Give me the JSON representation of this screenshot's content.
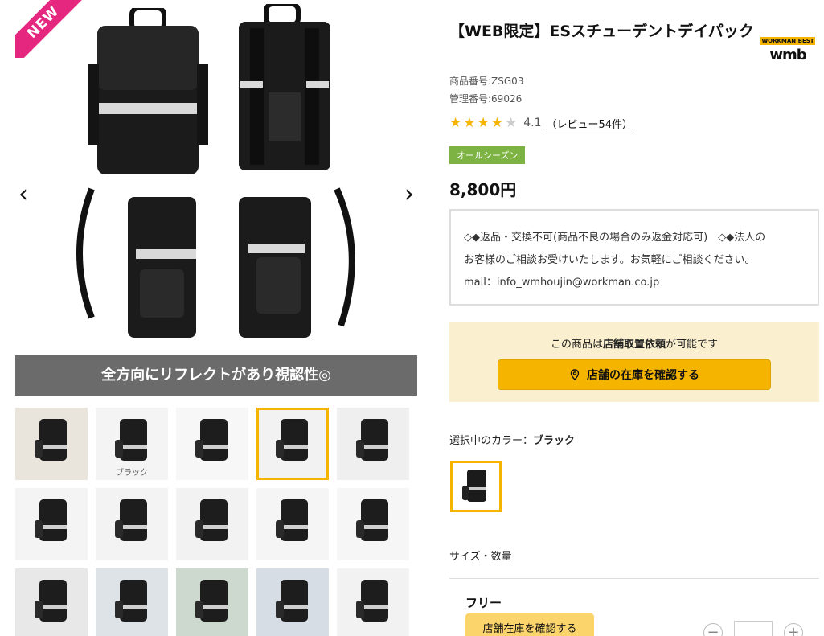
{
  "gallery": {
    "badge": "NEW",
    "prev_icon": "‹",
    "next_icon": "›",
    "caption": "全方向にリフレクトがあり視認性◎",
    "thumbnails": [
      {
        "label": ""
      },
      {
        "label": "ブラック"
      },
      {
        "label": ""
      },
      {
        "label": ""
      },
      {
        "label": ""
      },
      {
        "label": ""
      },
      {
        "label": ""
      },
      {
        "label": ""
      },
      {
        "label": ""
      },
      {
        "label": ""
      },
      {
        "label": ""
      },
      {
        "label": ""
      },
      {
        "label": ""
      },
      {
        "label": ""
      },
      {
        "label": ""
      }
    ],
    "active_thumb": 3
  },
  "product": {
    "title": "【WEB限定】ESスチューデントデイパック",
    "brand_top": "WORKMAN BEST",
    "brand_bottom": "wmb",
    "sku": "商品番号:ZSG03",
    "mgmt": "管理番号:69026",
    "rating": 4.1,
    "rating_text": "4.1",
    "reviews": "（レビュー54件）",
    "season": "オールシーズン",
    "price": "8,800円",
    "notice_lines": [
      "◇◆返品・交換不可(商品不良の場合のみ返金対応可)　◇◆法人の",
      "お客様のご相談お受けいたします。お気軽にご相談ください。",
      "mail：info_wmhoujin@workman.co.jp"
    ],
    "store_text_pre": "この商品は",
    "store_text_bold": "店舗取置依頼",
    "store_text_post": "が可能です",
    "store_button": "店舗の在庫を確認する",
    "color_label_prefix": "選択中のカラー：",
    "color_label_value": "ブラック",
    "size_label": "サイズ・数量",
    "size_name": "フリー",
    "stock_button": "店舗在庫を確認する",
    "qty_minus": "−",
    "qty_plus": "+",
    "qty_value": ""
  },
  "colors": {
    "accent": "#f4b400",
    "badge": "#e6277f",
    "season": "#7cb342",
    "store_bg": "#faefcf"
  }
}
